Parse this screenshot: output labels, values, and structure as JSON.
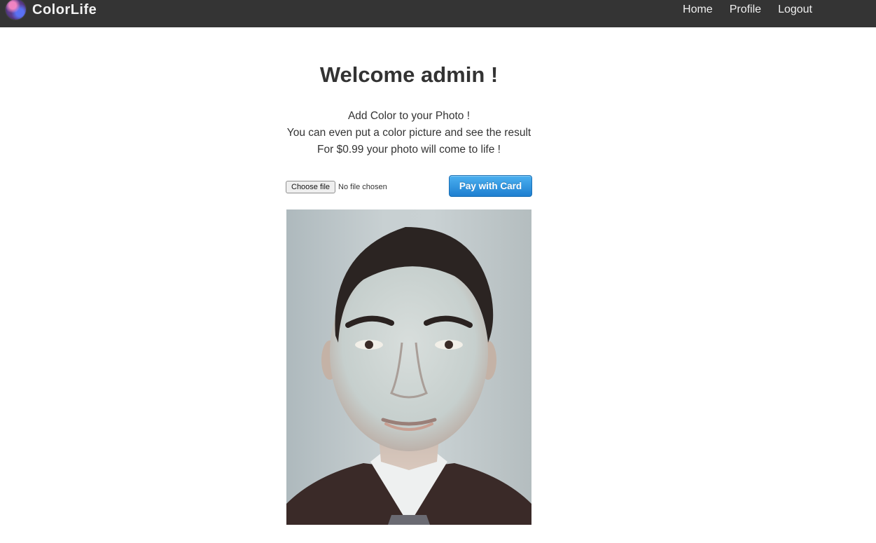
{
  "navbar": {
    "brand": "ColorLife",
    "links": [
      "Home",
      "Profile",
      "Logout"
    ]
  },
  "main": {
    "title": "Welcome admin !",
    "intro": [
      "Add Color to your Photo !",
      "You can even put a color picture and see the result",
      "For $0.99 your photo will come to life !"
    ],
    "upload": {
      "choose_label": "Choose file",
      "status": "No file chosen"
    },
    "pay_label": "Pay with Card"
  },
  "photo": {
    "description_icon": "portrait-photo"
  },
  "colors": {
    "navbar_bg": "#343434",
    "pay_button": "#1e7fd0",
    "text": "#333333"
  }
}
